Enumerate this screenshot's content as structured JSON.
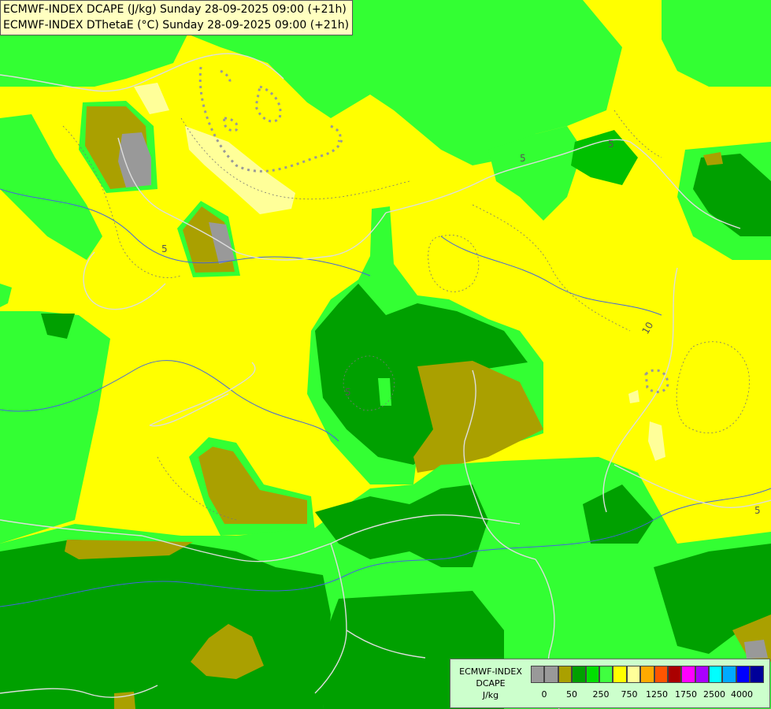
{
  "titles": {
    "line1": "ECMWF-INDEX DCAPE (J/kg) Sunday 28-09-2025 09:00 (+21h)",
    "line2": "ECMWF-INDEX DThetaE (°C) Sunday 28-09-2025 09:00 (+21h)"
  },
  "legend": {
    "title_line1": "ECMWF-INDEX",
    "title_line2": "DCAPE",
    "unit": "J/kg",
    "swatch_colors": [
      "#999999",
      "#999999",
      "#aaa000",
      "#00a000",
      "#00e000",
      "#40ff40",
      "#ffff00",
      "#ffff99",
      "#ffaa00",
      "#ff5500",
      "#aa0000",
      "#ff00ff",
      "#aa00ff",
      "#00ffff",
      "#00aaff",
      "#0000ff",
      "#000099"
    ],
    "tick_labels": [
      "0",
      "50",
      "250",
      "750",
      "1250",
      "1750",
      "2500",
      "4000"
    ]
  },
  "field_colors": {
    "background": "#ffff00",
    "light_yellow": "#ffff99",
    "bright_green": "#33ff33",
    "mid_green": "#00d000",
    "dark_green": "#00a000",
    "olive": "#aaa000",
    "grey": "#999999",
    "border": "#dddddd",
    "river": "#4466dd"
  },
  "contour_labels": [
    "5",
    "5",
    "5",
    "5",
    "10",
    "5"
  ]
}
